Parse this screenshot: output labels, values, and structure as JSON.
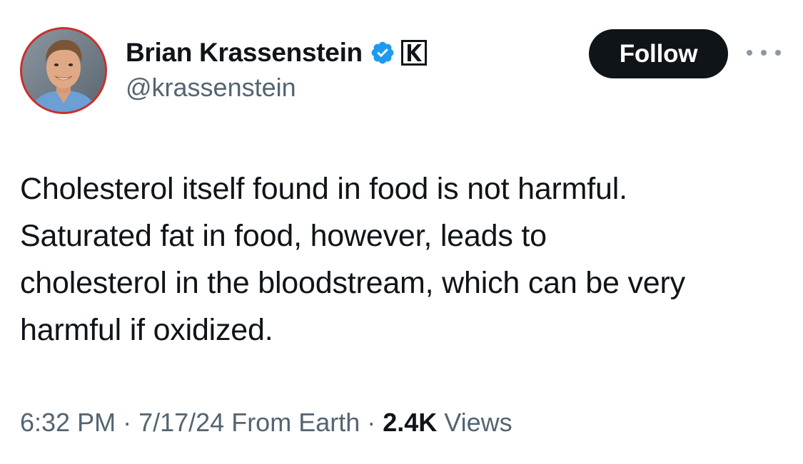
{
  "author": {
    "display_name": "Brian Krassenstein",
    "handle": "@krassenstein",
    "verified": true,
    "affiliate_badge_letter": "K"
  },
  "follow_label": "Follow",
  "tweet": {
    "lines": [
      "Cholesterol itself found in food is not harmful.",
      "Saturated fat in food, however, leads to",
      "cholesterol in the bloodstream, which can be very",
      "harmful if oxidized."
    ]
  },
  "meta": {
    "time": "6:32 PM",
    "separator": "·",
    "date": "7/17/24",
    "source": "From Earth",
    "views_count": "2.4K",
    "views_label": "Views"
  },
  "colors": {
    "text_primary": "#0f1419",
    "text_secondary": "#536471",
    "verified_blue": "#1d9bf0",
    "avatar_ring": "#c9302c"
  },
  "icons": {
    "verified": "verified-badge-icon",
    "affiliate": "affiliate-k-icon",
    "more": "more-options-icon"
  }
}
